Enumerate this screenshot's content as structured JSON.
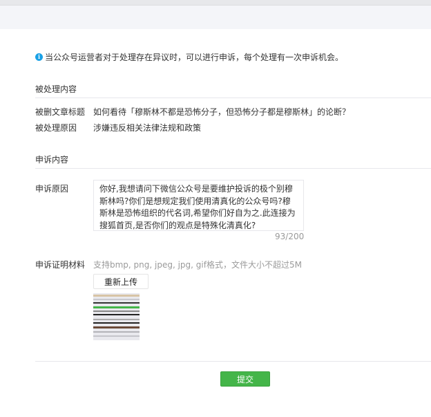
{
  "notice": {
    "text": "当公众号运营者对于处理存在异议时，可以进行申诉，每个处理有一次申诉机会。"
  },
  "processed": {
    "section_title": "被处理内容",
    "article_title_label": "被删文章标题",
    "article_title_value": "如何看待「穆斯林不都是恐怖分子，但恐怖分子都是穆斯林」的论断？",
    "reason_label": "被处理原因",
    "reason_value": "涉嫌违反相关法律法规和政策"
  },
  "appeal": {
    "section_title": "申诉内容",
    "reason_label": "申诉原因",
    "reason_text": "你好,我想请问下微信公众号是要维护投诉的极个别穆斯林吗?你们是想规定我们使用清真化的公众号吗?穆斯林是恐怖组织的代名词,希望你们好自为之.此连接为搜狐首页,是否你们的观点是特殊化清真化?",
    "counter": "93/200",
    "evidence_label": "申诉证明材料",
    "evidence_hint": "支持bmp, png, jpeg, jpg, gif格式，文件大小不超过5M",
    "reupload_label": "重新上传"
  },
  "submit_label": "提交",
  "colors": {
    "accent_green": "#44b549",
    "info_blue": "#1aa1e6"
  }
}
